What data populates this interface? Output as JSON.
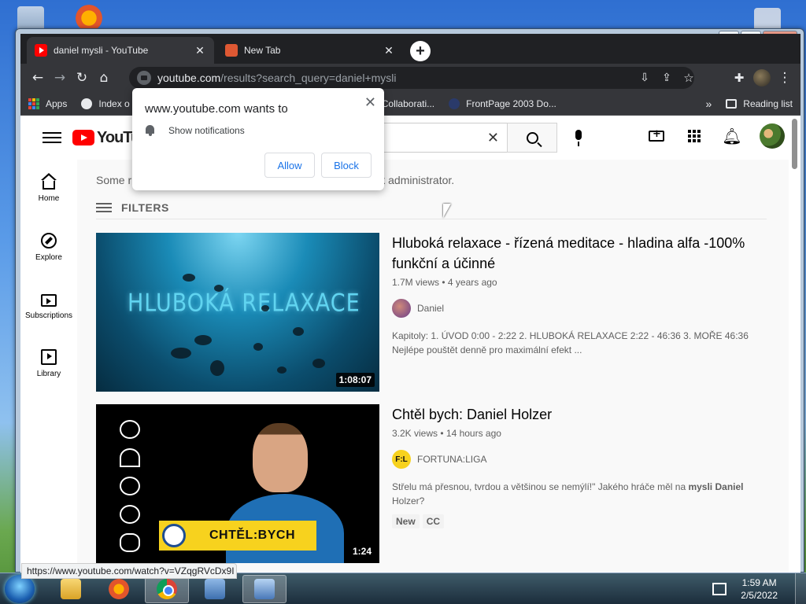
{
  "browser": {
    "tabs": [
      {
        "label": "daniel mysli - YouTube",
        "active": true,
        "icon": "youtube-favicon"
      },
      {
        "label": "New Tab",
        "active": false,
        "icon": "duckduckgo-favicon"
      }
    ],
    "new_tab_label": "+",
    "url_host": "youtube.com",
    "url_path": "/results?search_query=daniel+mysli",
    "bookmarks": [
      {
        "label": "Apps",
        "icon": "apps-grid-icon"
      },
      {
        "label": "Index o",
        "icon": "globe-icon"
      },
      {
        "label": "Control Collaborati...",
        "icon": "globe-icon"
      },
      {
        "label": "FrontPage 2003 Do...",
        "icon": "globe-icon"
      }
    ],
    "bookmarks_overflow": "»",
    "reading_list": "Reading list"
  },
  "popup": {
    "title": "www.youtube.com wants to",
    "permission": "Show notifications",
    "allow": "Allow",
    "block": "Block",
    "close": "✕"
  },
  "youtube": {
    "logo_text": "YouTube",
    "search_clear": "✕",
    "sidebar": [
      {
        "label": "Home",
        "icon": "home-icon"
      },
      {
        "label": "Explore",
        "icon": "explore-icon"
      },
      {
        "label": "Subscriptions",
        "icon": "subscriptions-icon"
      },
      {
        "label": "Library",
        "icon": "library-icon"
      }
    ],
    "notice": "Some r                                     e is enabled by your network administrator.",
    "filters_label": "FILTERS",
    "results": [
      {
        "title": "Hluboká relaxace - řízená meditace - hladina alfa -100% funkční a účinné",
        "meta": "1.7M views • 4 years ago",
        "channel": "Daniel",
        "description": "Kapitoly: 1. ÚVOD 0:00 - 2:22 2. HLUBOKÁ RELAXACE 2:22 - 46:36 3. MOŘE 46:36 Nejlépe pouštět denně pro maximální efekt ...",
        "duration": "1:08:07",
        "thumb_text": "HLUBOKÁ RELAXACE"
      },
      {
        "title": "Chtěl bych: Daniel Holzer",
        "meta": "3.2K views • 14 hours ago",
        "channel": "FORTUNA:LIGA",
        "channel_badge": "F:L",
        "description_pre": "Střelu má přesnou, tvrdou a většinou se nemýlí!\" Jakého hráče měl na ",
        "description_bold": "mysli Daniel",
        "description_post": " Holzer?",
        "badges": [
          "New",
          "CC"
        ],
        "duration": "1:24",
        "thumb_text": "CHTĚL:BYCH"
      }
    ]
  },
  "status_url": "https://www.youtube.com/watch?v=VZqgRVcDx9I",
  "taskbar": {
    "time": "1:59 AM",
    "date": "2/5/2022"
  },
  "colors": {
    "youtube_red": "#ff0000",
    "chrome_dark": "#202124",
    "chrome_toolbar": "#35363a",
    "link_blue": "#1a73e8",
    "fortuna_yellow": "#f7d21e"
  }
}
